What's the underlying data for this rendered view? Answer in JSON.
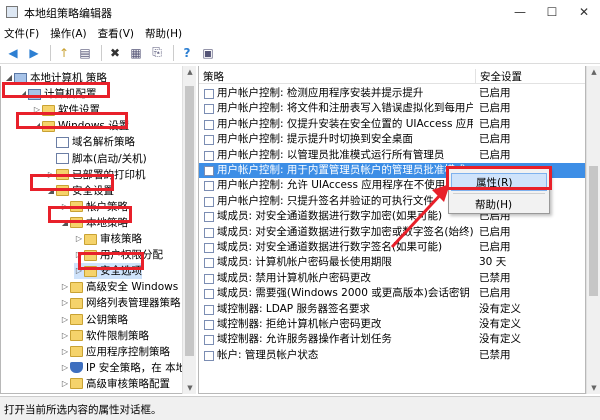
{
  "window": {
    "title": "本地组策略编辑器",
    "minimize": "—",
    "maximize": "☐",
    "close": "✕"
  },
  "menu": [
    "文件(F)",
    "操作(A)",
    "查看(V)",
    "帮助(H)"
  ],
  "toolbar": {
    "back": "◀",
    "forward": "▶",
    "up": "↑",
    "show_hide": "▤",
    "delete": "✖",
    "properties": "▦",
    "export": "⎘",
    "help": "?",
    "view": "▣"
  },
  "tree": [
    {
      "label": "本地计算机 策略",
      "indent": 0,
      "icon": "computer",
      "expanded": true
    },
    {
      "label": "计算机配置",
      "indent": 1,
      "icon": "computer",
      "expanded": true
    },
    {
      "label": "软件设置",
      "indent": 2,
      "icon": "folder",
      "expanded": false
    },
    {
      "label": "Windows 设置",
      "indent": 2,
      "icon": "folder",
      "expanded": true
    },
    {
      "label": "域名解析策略",
      "indent": 3,
      "icon": "doc",
      "expanded": null
    },
    {
      "label": "脚本(启动/关机)",
      "indent": 3,
      "icon": "doc",
      "expanded": null
    },
    {
      "label": "已部署的打印机",
      "indent": 3,
      "icon": "folder",
      "expanded": false
    },
    {
      "label": "安全设置",
      "indent": 3,
      "icon": "folder",
      "expanded": true
    },
    {
      "label": "帐户策略",
      "indent": 4,
      "icon": "folder",
      "expanded": false
    },
    {
      "label": "本地策略",
      "indent": 4,
      "icon": "folder",
      "expanded": true
    },
    {
      "label": "审核策略",
      "indent": 5,
      "icon": "folder",
      "expanded": false
    },
    {
      "label": "用户权限分配",
      "indent": 5,
      "icon": "folder",
      "expanded": false
    },
    {
      "label": "安全选项",
      "indent": 5,
      "icon": "folder",
      "expanded": false,
      "selected": true
    },
    {
      "label": "高级安全 Windows 防",
      "indent": 4,
      "icon": "folder",
      "expanded": false
    },
    {
      "label": "网络列表管理器策略",
      "indent": 4,
      "icon": "folder",
      "expanded": false
    },
    {
      "label": "公钥策略",
      "indent": 4,
      "icon": "folder",
      "expanded": false
    },
    {
      "label": "软件限制策略",
      "indent": 4,
      "icon": "folder",
      "expanded": false
    },
    {
      "label": "应用程序控制策略",
      "indent": 4,
      "icon": "folder",
      "expanded": false
    },
    {
      "label": "IP 安全策略，在 本地计",
      "indent": 4,
      "icon": "shield",
      "expanded": false
    },
    {
      "label": "高级审核策略配置",
      "indent": 4,
      "icon": "folder",
      "expanded": false
    }
  ],
  "columns": {
    "policy": "策略",
    "setting": "安全设置"
  },
  "rows": [
    {
      "policy": "用户帐户控制: 检测应用程序安装并提示提升",
      "setting": "已启用"
    },
    {
      "policy": "用户帐户控制: 将文件和注册表写入错误虚拟化到每用户位置",
      "setting": "已启用"
    },
    {
      "policy": "用户帐户控制: 仅提升安装在安全位置的 UIAccess 应用程序",
      "setting": "已启用"
    },
    {
      "policy": "用户帐户控制: 提示提升时切换到安全桌面",
      "setting": "已启用"
    },
    {
      "policy": "用户帐户控制: 以管理员批准模式运行所有管理员",
      "setting": "已启用"
    },
    {
      "policy": "用户帐户控制: 用于内置管理员帐户的管理员批准模式",
      "setting": "",
      "selected": true
    },
    {
      "policy": "用户帐户控制: 允许 UIAccess 应用程序在不使用安全桌",
      "setting": ""
    },
    {
      "policy": "用户帐户控制: 只提升签名并验证的可执行文件",
      "setting": ""
    },
    {
      "policy": "域成员: 对安全通道数据进行数字加密(如果可能)",
      "setting": "已启用"
    },
    {
      "policy": "域成员: 对安全通道数据进行数字加密或数字签名(始终)",
      "setting": "已启用"
    },
    {
      "policy": "域成员: 对安全通道数据进行数字签名(如果可能)",
      "setting": "已启用"
    },
    {
      "policy": "域成员: 计算机帐户密码最长使用期限",
      "setting": "30 天"
    },
    {
      "policy": "域成员: 禁用计算机帐户密码更改",
      "setting": "已禁用"
    },
    {
      "policy": "域成员: 需要强(Windows 2000 或更高版本)会话密钥",
      "setting": "已启用"
    },
    {
      "policy": "域控制器: LDAP 服务器签名要求",
      "setting": "没有定义"
    },
    {
      "policy": "域控制器: 拒绝计算机帐户密码更改",
      "setting": "没有定义"
    },
    {
      "policy": "域控制器: 允许服务器操作者计划任务",
      "setting": "没有定义"
    },
    {
      "policy": "帐户: 管理员帐户状态",
      "setting": "已禁用"
    }
  ],
  "context_menu": {
    "properties": "属性(R)",
    "help": "帮助(H)"
  },
  "status": "打开当前所选内容的属性对话框。",
  "colors": {
    "annotation": "#e8202a",
    "selection": "#3d8ee6"
  }
}
